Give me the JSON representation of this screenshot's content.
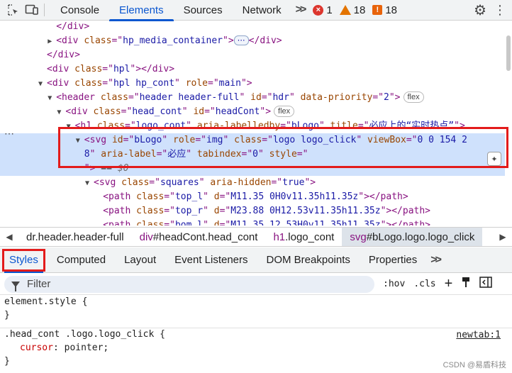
{
  "toolbar": {
    "tabs": [
      {
        "label": "Console",
        "active": false
      },
      {
        "label": "Elements",
        "active": true
      },
      {
        "label": "Sources",
        "active": false
      },
      {
        "label": "Network",
        "active": false
      }
    ],
    "more_tabs": ">>",
    "errors_count": "1",
    "warnings_count": "18",
    "issues_count": "18",
    "error_glyph": "×",
    "issue_glyph": "!",
    "gear": "⚙",
    "kebab": "⋮"
  },
  "dom": {
    "rows": [
      {
        "indent": 6,
        "tri": "",
        "html": "</div>"
      },
      {
        "indent": 6,
        "tri": "▶",
        "parts": [
          [
            "tag",
            "<div "
          ],
          [
            "attr",
            "class"
          ],
          [
            "tag",
            "=\""
          ],
          [
            "val",
            "hp_media_container"
          ],
          [
            "tag",
            "\">"
          ],
          [
            "ellip",
            "⋯"
          ],
          [
            "tag",
            "</div>"
          ]
        ]
      },
      {
        "indent": 5,
        "tri": "",
        "parts": [
          [
            "tag",
            "</div>"
          ]
        ]
      },
      {
        "indent": 5,
        "tri": "",
        "parts": [
          [
            "tag",
            "<div "
          ],
          [
            "attr",
            "class"
          ],
          [
            "tag",
            "=\""
          ],
          [
            "val",
            "hpl"
          ],
          [
            "tag",
            "\"></div>"
          ]
        ]
      },
      {
        "indent": 5,
        "tri": "▼",
        "parts": [
          [
            "tag",
            "<div "
          ],
          [
            "attr",
            "class"
          ],
          [
            "tag",
            "=\""
          ],
          [
            "val",
            "hpl hp_cont"
          ],
          [
            "tag",
            "\" "
          ],
          [
            "attr",
            "role"
          ],
          [
            "tag",
            "=\""
          ],
          [
            "val",
            "main"
          ],
          [
            "tag",
            "\">"
          ]
        ]
      },
      {
        "indent": 6,
        "tri": "▼",
        "parts": [
          [
            "tag",
            "<header "
          ],
          [
            "attr",
            "class"
          ],
          [
            "tag",
            "=\""
          ],
          [
            "val",
            "header header-full"
          ],
          [
            "tag",
            "\" "
          ],
          [
            "attr",
            "id"
          ],
          [
            "tag",
            "=\""
          ],
          [
            "val",
            "hdr"
          ],
          [
            "tag",
            "\" "
          ],
          [
            "attr",
            "data-priority"
          ],
          [
            "tag",
            "=\""
          ],
          [
            "val",
            "2"
          ],
          [
            "tag",
            "\">"
          ],
          [
            "pill",
            "flex"
          ]
        ]
      },
      {
        "indent": 7,
        "tri": "▼",
        "parts": [
          [
            "tag",
            "<div "
          ],
          [
            "attr",
            "class"
          ],
          [
            "tag",
            "=\""
          ],
          [
            "val",
            "head_cont"
          ],
          [
            "tag",
            "\" "
          ],
          [
            "attr",
            "id"
          ],
          [
            "tag",
            "=\""
          ],
          [
            "val",
            "headCont"
          ],
          [
            "tag",
            "\">"
          ],
          [
            "pill",
            "flex"
          ]
        ]
      },
      {
        "indent": 8,
        "tri": "▼",
        "parts": [
          [
            "tag",
            "<h1 "
          ],
          [
            "attr",
            "class"
          ],
          [
            "tag",
            "=\""
          ],
          [
            "val",
            "logo_cont"
          ],
          [
            "tag",
            "\" "
          ],
          [
            "attr",
            "aria-labelledby"
          ],
          [
            "tag",
            "=\""
          ],
          [
            "val",
            "bLogo"
          ],
          [
            "tag",
            "\" "
          ],
          [
            "attr",
            "title"
          ],
          [
            "tag",
            "=\""
          ],
          [
            "val",
            "必应上的“实时热点”"
          ],
          [
            "tag",
            "\">"
          ]
        ]
      },
      {
        "indent": 9,
        "tri": "▼",
        "sel": true,
        "parts": [
          [
            "tag",
            "<svg "
          ],
          [
            "attr",
            "id"
          ],
          [
            "tag",
            "=\""
          ],
          [
            "val",
            "bLogo"
          ],
          [
            "tag",
            "\" "
          ],
          [
            "attr",
            "role"
          ],
          [
            "tag",
            "=\""
          ],
          [
            "val",
            "img"
          ],
          [
            "tag",
            "\" "
          ],
          [
            "attr",
            "class"
          ],
          [
            "tag",
            "=\""
          ],
          [
            "val",
            "logo logo_click"
          ],
          [
            "tag",
            "\" "
          ],
          [
            "attr",
            "viewBox"
          ],
          [
            "tag",
            "=\""
          ],
          [
            "val",
            "0 0 154 2"
          ]
        ]
      },
      {
        "indent": 9,
        "tri": "",
        "sel": true,
        "parts": [
          [
            "val",
            "8"
          ],
          [
            "tag",
            "\" "
          ],
          [
            "attr",
            "aria-label"
          ],
          [
            "tag",
            "=\""
          ],
          [
            "val",
            "必应"
          ],
          [
            "tag",
            "\" "
          ],
          [
            "attr",
            "tabindex"
          ],
          [
            "tag",
            "=\""
          ],
          [
            "val",
            "0"
          ],
          [
            "tag",
            "\" "
          ],
          [
            "attr",
            "style"
          ],
          [
            "tag",
            "=\""
          ]
        ]
      },
      {
        "indent": 9,
        "tri": "",
        "sel": true,
        "parts": [
          [
            "tag",
            "\">"
          ],
          [
            "txt",
            " == "
          ],
          [
            "eq0",
            "$0"
          ]
        ]
      },
      {
        "indent": 10,
        "tri": "▼",
        "parts": [
          [
            "tag",
            "<svg "
          ],
          [
            "attr",
            "class"
          ],
          [
            "tag",
            "=\""
          ],
          [
            "val",
            "squares"
          ],
          [
            "tag",
            "\" "
          ],
          [
            "attr",
            "aria-hidden"
          ],
          [
            "tag",
            "=\""
          ],
          [
            "val",
            "true"
          ],
          [
            "tag",
            "\">"
          ]
        ]
      },
      {
        "indent": 11,
        "tri": "",
        "parts": [
          [
            "tag",
            "<path "
          ],
          [
            "attr",
            "class"
          ],
          [
            "tag",
            "=\""
          ],
          [
            "val",
            "top_l"
          ],
          [
            "tag",
            "\" "
          ],
          [
            "attr",
            "d"
          ],
          [
            "tag",
            "=\""
          ],
          [
            "val",
            "M11.35 0H0v11.35h11.35z"
          ],
          [
            "tag",
            "\"></path>"
          ]
        ]
      },
      {
        "indent": 11,
        "tri": "",
        "parts": [
          [
            "tag",
            "<path "
          ],
          [
            "attr",
            "class"
          ],
          [
            "tag",
            "=\""
          ],
          [
            "val",
            "top_r"
          ],
          [
            "tag",
            "\" "
          ],
          [
            "attr",
            "d"
          ],
          [
            "tag",
            "=\""
          ],
          [
            "val",
            "M23.88 0H12.53v11.35h11.35z"
          ],
          [
            "tag",
            "\"></path>"
          ]
        ]
      },
      {
        "indent": 11,
        "tri": "",
        "parts": [
          [
            "tag",
            "<path "
          ],
          [
            "attr",
            "class"
          ],
          [
            "tag",
            "=\""
          ],
          [
            "val",
            "bom_l"
          ],
          [
            "tag",
            "\" "
          ],
          [
            "attr",
            "d"
          ],
          [
            "tag",
            "=\""
          ],
          [
            "val",
            "M11.35 12.53H0v11.35h11.35z"
          ],
          [
            "tag",
            "\"></path>"
          ]
        ]
      }
    ],
    "gutter_dots": "⋯",
    "ai_glyph": "✦"
  },
  "breadcrumbs": [
    {
      "tag": "",
      "rest": "dr.header.header-full",
      "selected": false
    },
    {
      "tag": "div",
      "rest": "#headCont.head_cont",
      "selected": false
    },
    {
      "tag": "h1",
      "rest": ".logo_cont",
      "selected": false
    },
    {
      "tag": "svg",
      "rest": "#bLogo.logo.logo_click",
      "selected": true
    }
  ],
  "subtabs": [
    {
      "label": "Styles",
      "active": true
    },
    {
      "label": "Computed",
      "active": false
    },
    {
      "label": "Layout",
      "active": false
    },
    {
      "label": "Event Listeners",
      "active": false
    },
    {
      "label": "DOM Breakpoints",
      "active": false
    },
    {
      "label": "Properties",
      "active": false
    }
  ],
  "subtabs_more": ">>",
  "filter": {
    "placeholder": "Filter",
    "hov": ":hov",
    "cls": ".cls",
    "plus": "+"
  },
  "styles": {
    "element_style_selector": "element.style {",
    "close_brace": "}",
    "rule_selector": ".head_cont .logo.logo_click {",
    "rule_prop": "cursor",
    "rule_value": "pointer;",
    "rule_source": "newtab:1"
  },
  "watermark": "CSDN @易盾科技",
  "colors": {
    "accent": "#0b57d0",
    "error": "#dc362e",
    "warning": "#e37400",
    "selection": "#cfe1fc",
    "highlight_box": "#e31b1b"
  }
}
